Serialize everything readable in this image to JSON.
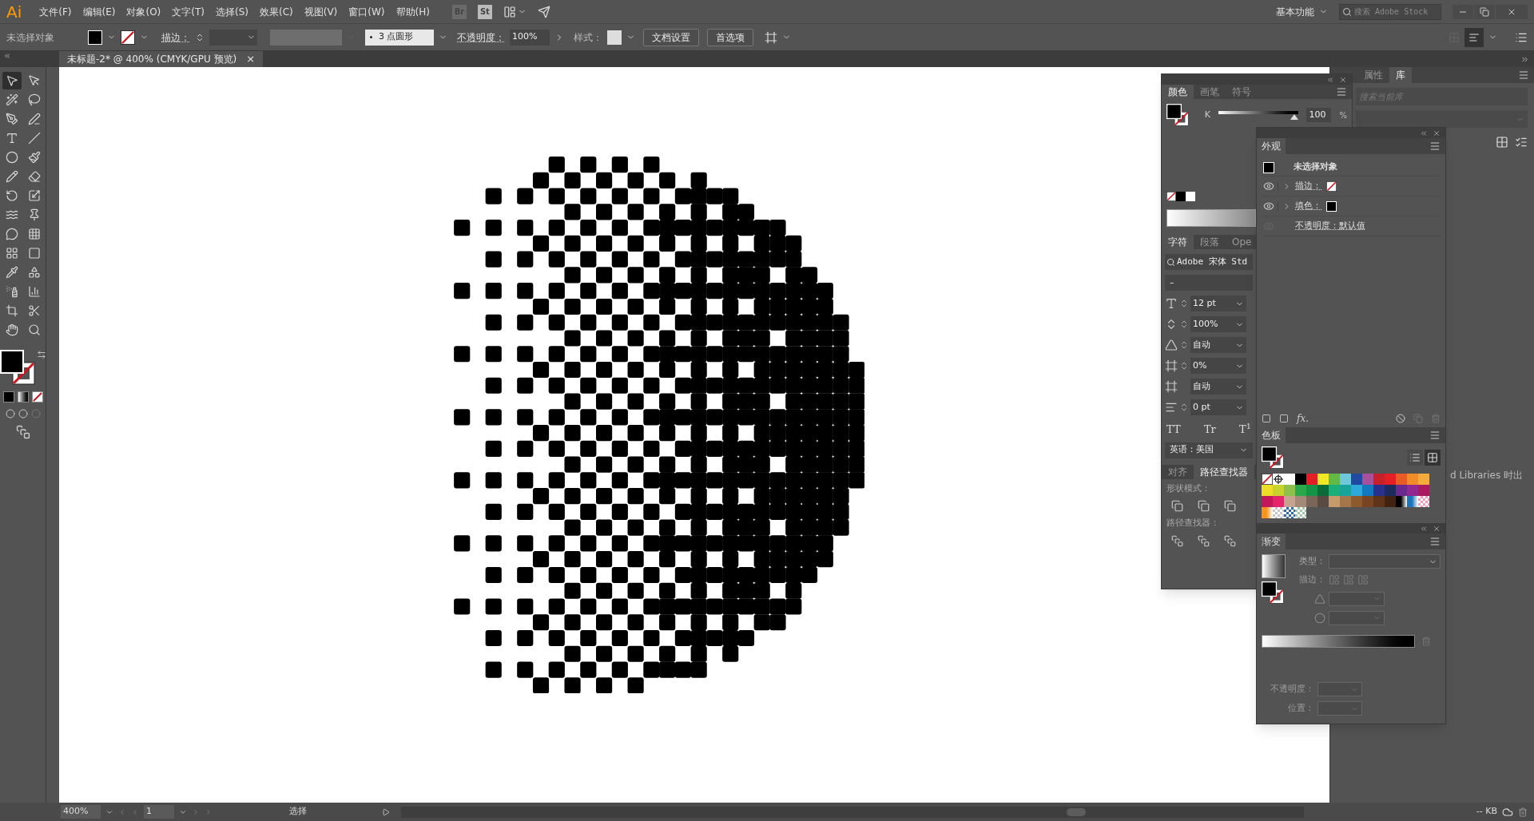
{
  "menu_bar": {
    "logo": "Ai",
    "menus": [
      "文件(F)",
      "编辑(E)",
      "对象(O)",
      "文字(T)",
      "选择(S)",
      "效果(C)",
      "视图(V)",
      "窗口(W)",
      "帮助(H)"
    ],
    "bridge": "Br",
    "stock": "St",
    "workspace": "基本功能",
    "stock_search": {
      "placeholder": "搜索 Adobe Stock"
    }
  },
  "control_bar": {
    "selection": "未选择对象",
    "stroke_label": "描边：",
    "brush": "3 点圆形",
    "opacity_label": "不透明度：",
    "opacity": "100%",
    "style_label": "样式：",
    "buttons": [
      "文档设置",
      "首选项"
    ]
  },
  "document_tab": {
    "title": "未标题-2* @ 400% (CMYK/GPU 预览)",
    "close": "×"
  },
  "tools": [
    {
      "selected": true
    },
    {
      "selected": false
    },
    {
      "selected": false
    },
    {
      "selected": false
    },
    {
      "selected": false
    },
    {
      "selected": false
    },
    {
      "selected": false
    },
    {
      "selected": false
    },
    {
      "selected": false
    },
    {
      "selected": false
    },
    {
      "selected": false
    },
    {
      "selected": false
    },
    {
      "selected": false
    },
    {
      "selected": false
    },
    {
      "selected": false
    },
    {
      "selected": false
    },
    {
      "selected": false
    },
    {
      "selected": false
    },
    {
      "selected": false
    },
    {
      "selected": false
    },
    {
      "selected": false
    },
    {
      "selected": false
    },
    {
      "selected": false
    },
    {
      "selected": false
    },
    {
      "selected": false
    },
    {
      "selected": false
    },
    {
      "selected": false
    },
    {
      "selected": false
    }
  ],
  "color_panel": {
    "tabs": [
      {
        "label": "颜色",
        "selected": true
      },
      {
        "label": "画笔",
        "selected": false
      },
      {
        "label": "符号",
        "selected": false
      }
    ],
    "channel": "K",
    "level": 1,
    "value": "100",
    "unit": "%"
  },
  "character_panel": {
    "tabs": [
      {
        "label": "字符",
        "selected": true
      },
      {
        "label": "段落",
        "selected": false
      },
      {
        "label": "Ope",
        "selected": false
      }
    ],
    "font": "Adobe 宋体 Std",
    "style": "–",
    "fields": [
      {
        "value": "12 pt",
        "stepper": true
      },
      {
        "value": "100%",
        "stepper": true
      },
      {
        "value": "自动",
        "stepper": true
      },
      {
        "value": "0%",
        "stepper": true
      },
      {
        "value": "自动",
        "stepper": false
      },
      {
        "value": "0 pt",
        "stepper": true
      }
    ],
    "case_buttons": [
      "TT",
      "Tr",
      "T$^{1}$"
    ],
    "language": "英语：美国"
  },
  "pathfinder_panel": {
    "tabs": [
      {
        "label": "对齐",
        "selected": false
      },
      {
        "label": "路径查找器",
        "selected": true
      }
    ],
    "shape_modes_label": "形状模式：",
    "pathfinders_label": "路径查找器："
  },
  "appearance_panel": {
    "title": "外观",
    "target": "未选择对象",
    "rows": [
      {
        "kind": "stroke",
        "label": "描边：",
        "visible": true
      },
      {
        "kind": "fill",
        "label": "填色：",
        "visible": true
      },
      {
        "kind": "opacity",
        "label": "不透明度：默认值",
        "visible": false
      }
    ],
    "fx": "fx."
  },
  "swatches_panel": {
    "title": "色板",
    "view_buttons": [
      {
        "selected": false
      },
      {
        "selected": true
      }
    ],
    "swatches": [
      {
        "kind": "none"
      },
      {
        "kind": "registration",
        "color": "#ffffff"
      },
      {
        "kind": "solid",
        "color": "#ffffff"
      },
      {
        "kind": "solid",
        "color": "#000000"
      },
      {
        "kind": "solid",
        "color": "#e41e26"
      },
      {
        "kind": "solid",
        "color": "#f1e925"
      },
      {
        "kind": "solid",
        "color": "#62b946"
      },
      {
        "kind": "solid",
        "color": "#6ec8dc"
      },
      {
        "kind": "solid",
        "color": "#1f4aa0"
      },
      {
        "kind": "solid",
        "color": "#a7509c"
      },
      {
        "kind": "solid",
        "color": "#c8202b"
      },
      {
        "kind": "solid",
        "color": "#e31e24"
      },
      {
        "kind": "solid",
        "color": "#e95b24"
      },
      {
        "kind": "solid",
        "color": "#f08d28"
      },
      {
        "kind": "solid",
        "color": "#f4ab3c"
      },
      {
        "kind": "solid",
        "color": "#ecde27"
      },
      {
        "kind": "solid",
        "color": "#c8d32d"
      },
      {
        "kind": "solid",
        "color": "#8dc14b"
      },
      {
        "kind": "solid",
        "color": "#2aa84a"
      },
      {
        "kind": "solid",
        "color": "#149444"
      },
      {
        "kind": "solid",
        "color": "#0b6c39"
      },
      {
        "kind": "solid",
        "color": "#1aae78"
      },
      {
        "kind": "solid",
        "color": "#18a49b"
      },
      {
        "kind": "solid",
        "color": "#2fa8dc"
      },
      {
        "kind": "solid",
        "color": "#1378bd"
      },
      {
        "kind": "solid",
        "color": "#27318b"
      },
      {
        "kind": "solid",
        "color": "#1d2a5e"
      },
      {
        "kind": "solid",
        "color": "#6a2a8d"
      },
      {
        "kind": "solid",
        "color": "#92278f"
      },
      {
        "kind": "solid",
        "color": "#a8195f"
      },
      {
        "kind": "solid",
        "color": "#c2185b"
      },
      {
        "kind": "solid",
        "color": "#e4246b"
      },
      {
        "kind": "solid",
        "color": "#c5a48f"
      },
      {
        "kind": "solid",
        "color": "#a38977"
      },
      {
        "kind": "solid",
        "color": "#7a6559"
      },
      {
        "kind": "solid",
        "color": "#5a4a44"
      },
      {
        "kind": "solid",
        "color": "#c59a6d"
      },
      {
        "kind": "solid",
        "color": "#a5764a"
      },
      {
        "kind": "solid",
        "color": "#8d5a2d"
      },
      {
        "kind": "solid",
        "color": "#774424"
      },
      {
        "kind": "solid",
        "color": "#5e341b"
      },
      {
        "kind": "solid",
        "color": "#3f2211"
      },
      {
        "kind": "gradient",
        "color": "#000000"
      },
      {
        "kind": "gradient",
        "color": "#1b75bb"
      },
      {
        "kind": "pattern",
        "color": "#f39ab7"
      },
      {
        "kind": "gradient",
        "color": "#f7941d"
      },
      {
        "kind": "pattern",
        "color": "#c8c8c8"
      },
      {
        "kind": "pattern",
        "color": "#2e6aa8"
      },
      {
        "kind": "pattern",
        "color": "#9fc7a8"
      }
    ]
  },
  "gradient_panel": {
    "title": "渐变",
    "type_label": "类型：",
    "stroke_label": "描边：",
    "opacity_label": "不透明度：",
    "location_label": "位置："
  },
  "right_dock": {
    "tabs": [
      {
        "label": "属性",
        "selected": false
      },
      {
        "label": "库",
        "selected": true
      }
    ],
    "library_search": {
      "placeholder": "搜索当前库"
    },
    "message": "d Libraries 时出"
  },
  "status_bar": {
    "zoom": "400%",
    "artboard": "1",
    "tool": "选择",
    "file_size": "-- KB"
  }
}
